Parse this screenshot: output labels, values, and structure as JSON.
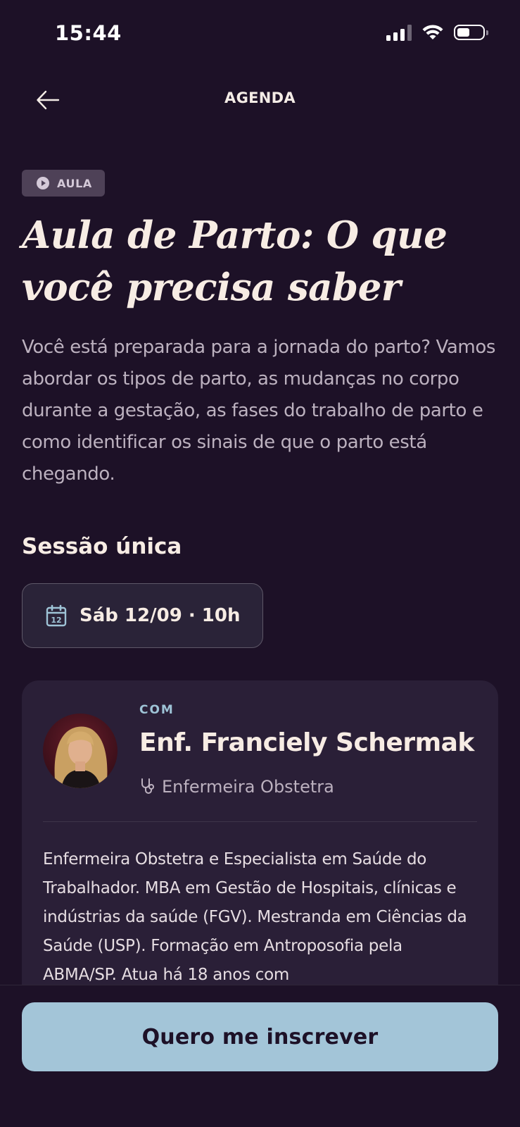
{
  "status_bar": {
    "time": "15:44",
    "icons": [
      "signal-icon",
      "wifi-icon",
      "battery-icon"
    ],
    "battery_level": 0.5
  },
  "header": {
    "title": "AGENDA",
    "back_icon": "arrow-left-icon"
  },
  "event": {
    "tag": {
      "icon": "play-circle-icon",
      "label": "AULA"
    },
    "title_line1": "Aula de Parto: O que",
    "title_line2": "você precisa saber",
    "description": "Você está preparada para a jornada do parto? Vamos abordar os tipos de parto, as mudanças no corpo durante a gestação, as fases do trabalho de parto e como identificar os sinais de que o parto está chegando."
  },
  "session": {
    "section_title": "Sessão única",
    "chip_icon": "calendar-icon",
    "calendar_day": "12",
    "date_label": "Sáb 12/09 · 10h"
  },
  "speaker": {
    "label": "COM",
    "name": "Enf. Franciely Schermak",
    "role_icon": "stethoscope-icon",
    "role": "Enfermeira Obstetra",
    "bio": "Enfermeira Obstetra e Especialista em Saúde do Trabalhador. MBA em Gestão de Hospitais, clínicas e indústrias da saúde (FGV). Mestranda em Ciências da Saúde (USP). Formação em Antroposofia pela ABMA/SP. Atua há 18 anos com"
  },
  "cta": {
    "label": "Quero me inscrever"
  },
  "colors": {
    "background": "#1d1127",
    "card": "#2a1f37",
    "accent": "#a3c5d8",
    "text_primary": "#f7ece4",
    "text_secondary": "#bcb1bf"
  }
}
